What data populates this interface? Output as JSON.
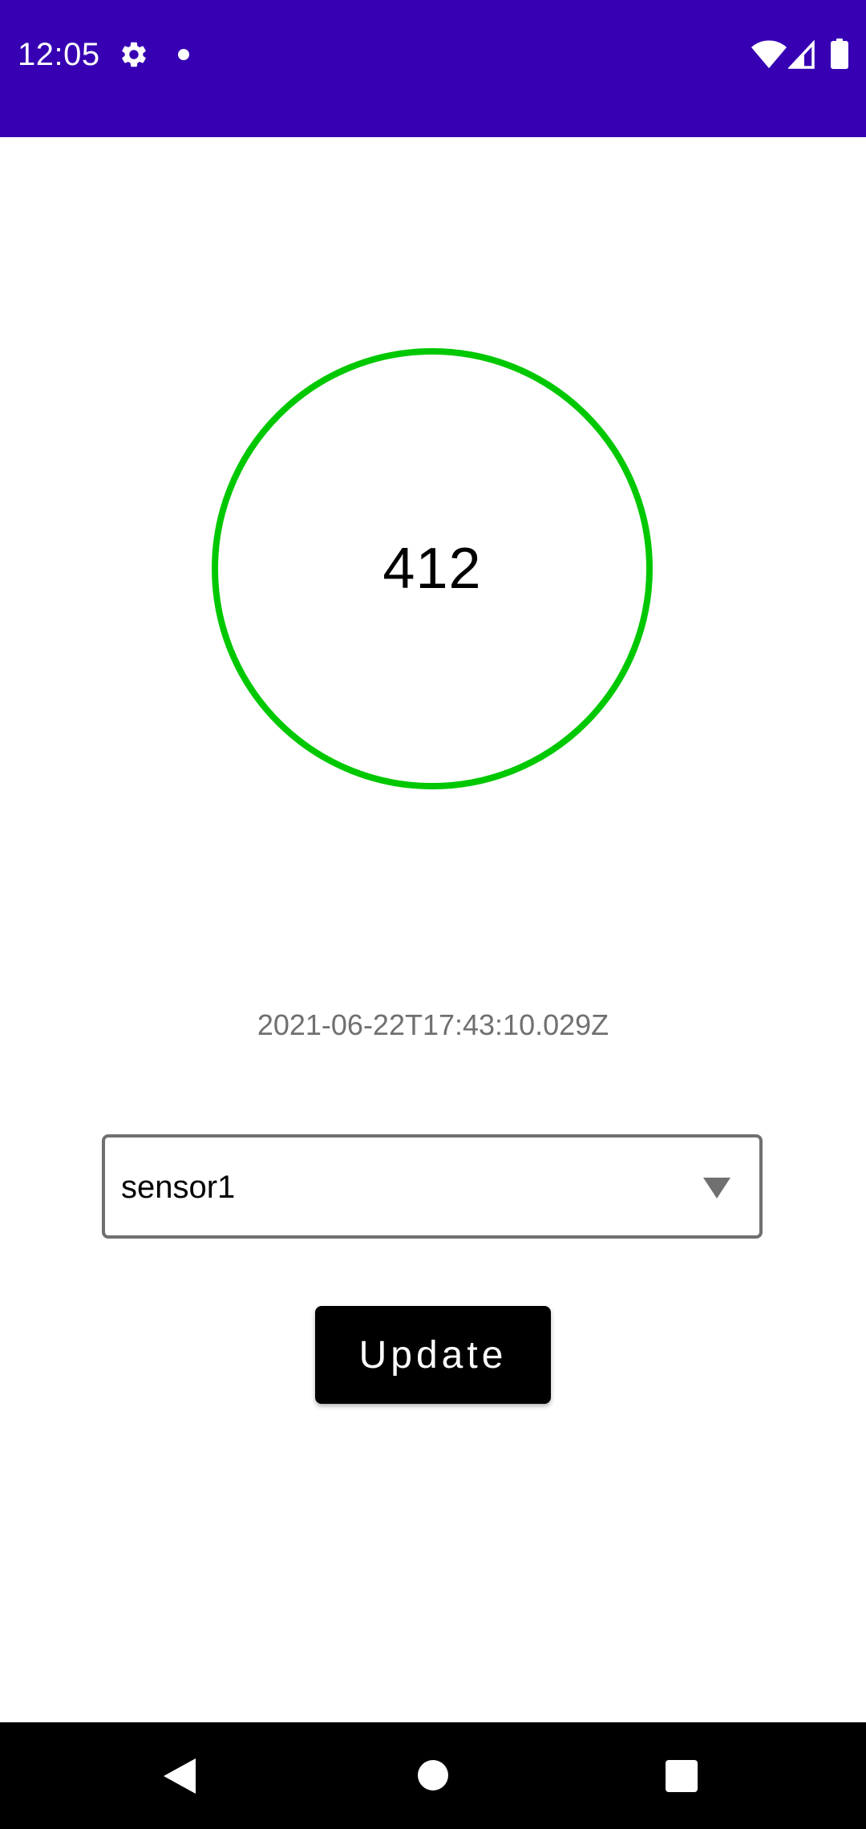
{
  "status_bar": {
    "time": "12:05",
    "background_color": "#3700b3",
    "icons": [
      "gear-icon",
      "notification-dot-icon",
      "wifi-icon",
      "signal-icon",
      "battery-icon"
    ]
  },
  "gauge": {
    "value": "412",
    "ring_color": "#00c800"
  },
  "reading": {
    "timestamp": "2021-06-22T17:43:10.029Z"
  },
  "sensor_select": {
    "selected": "sensor1",
    "arrow_icon": "dropdown-arrow-icon"
  },
  "actions": {
    "update_label": "Update"
  },
  "nav_bar": {
    "icons": [
      "back-icon",
      "home-icon",
      "recents-icon"
    ]
  }
}
